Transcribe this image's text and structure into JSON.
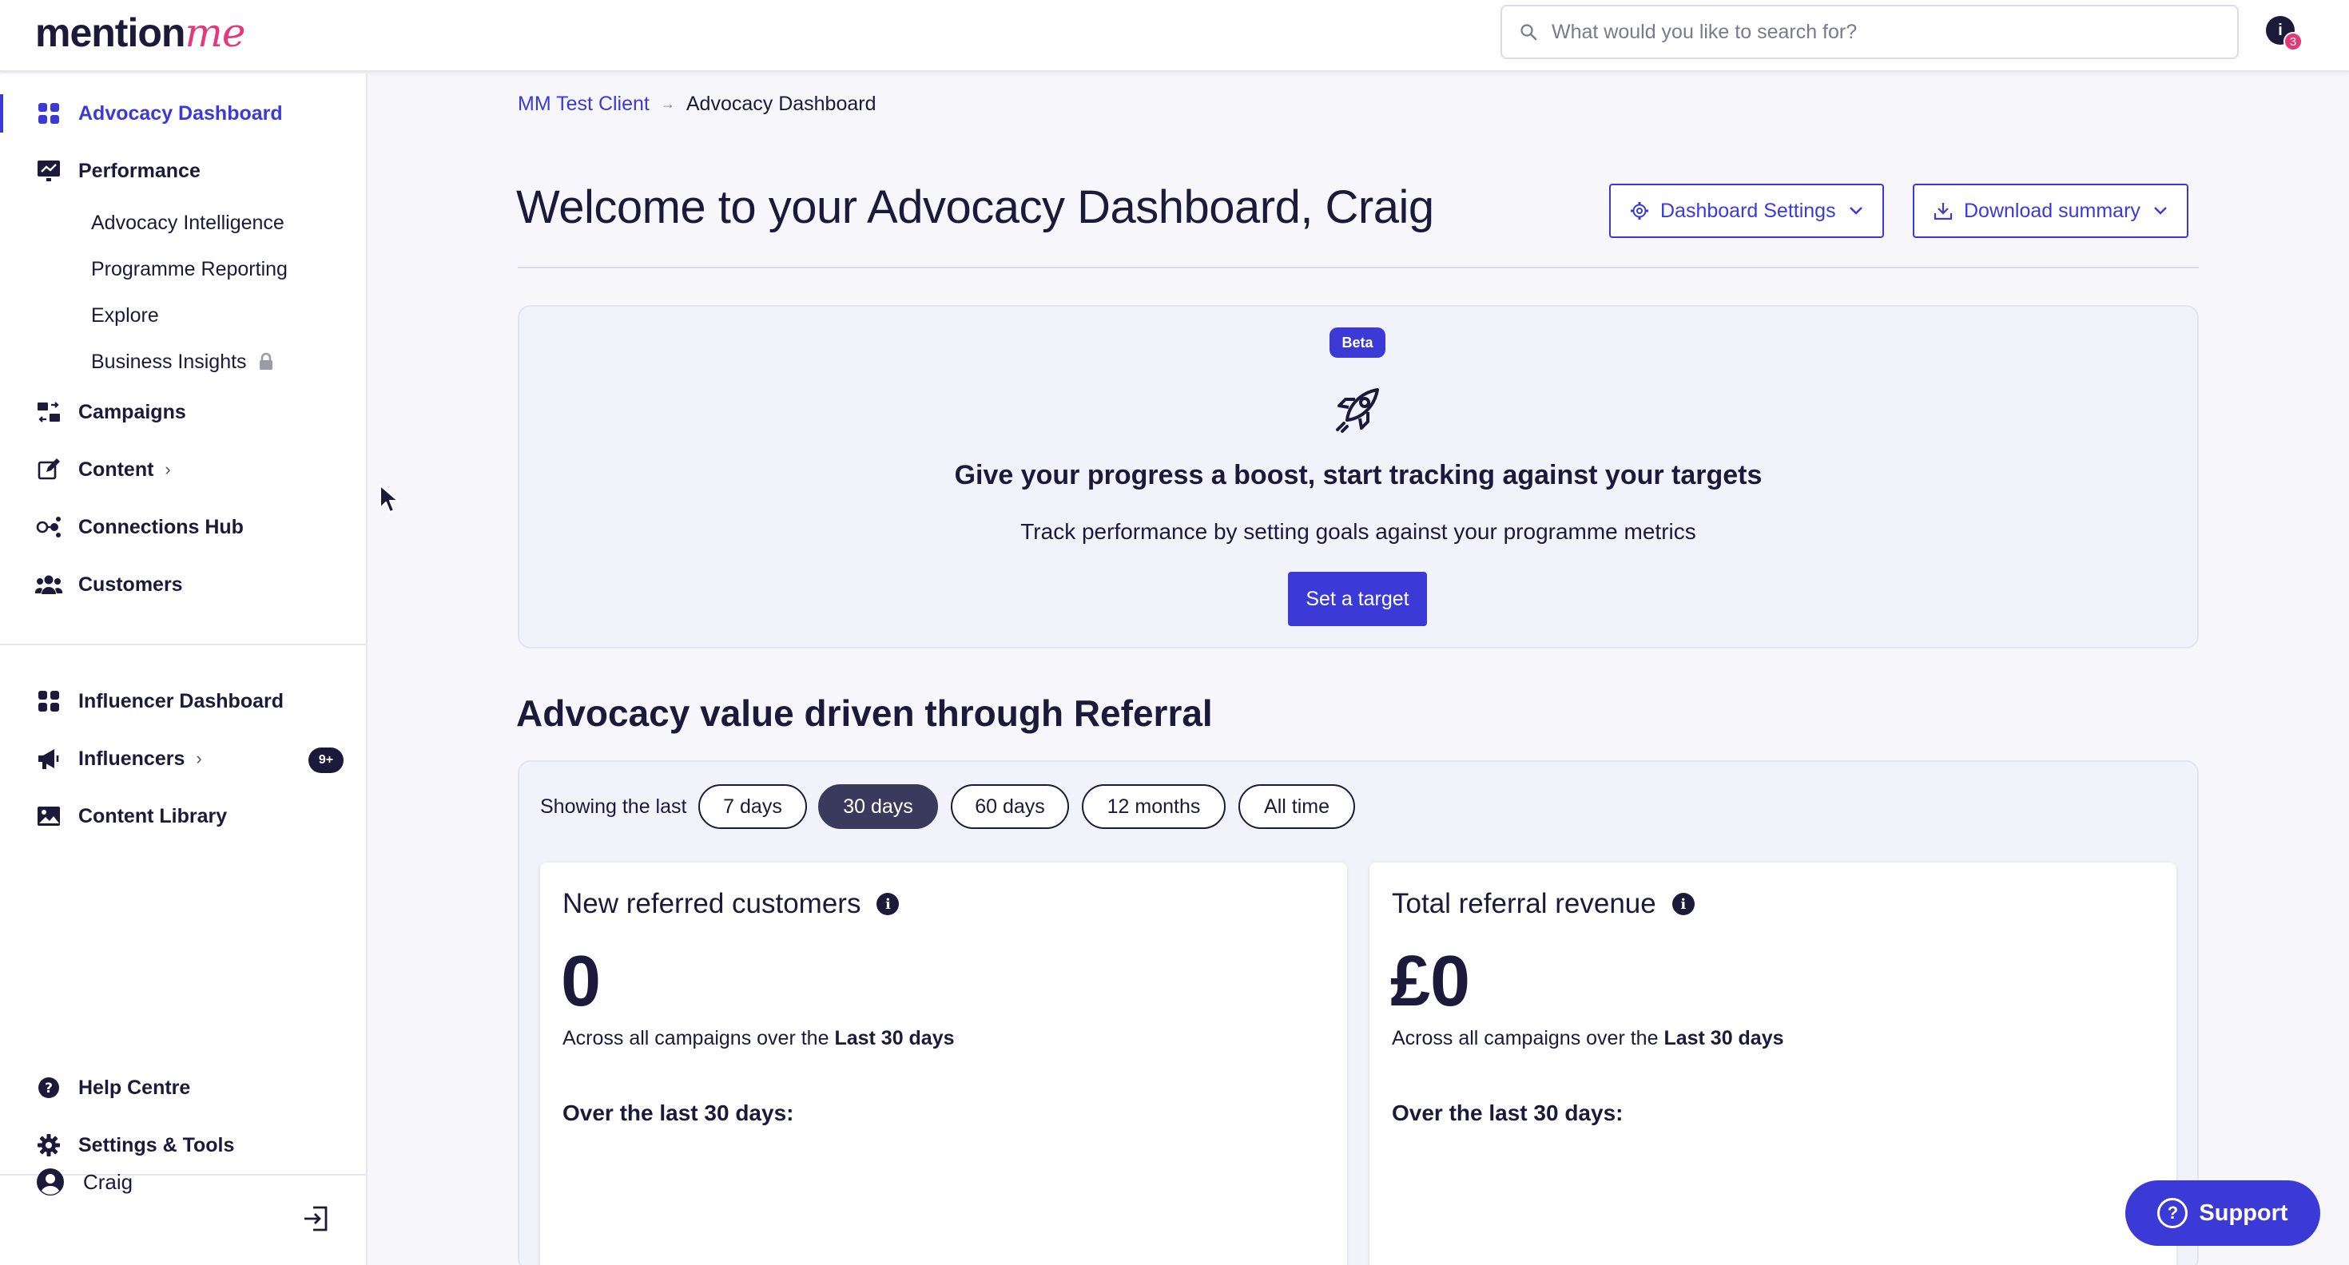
{
  "header": {
    "logo_part1": "mention",
    "logo_part2": "me",
    "search_placeholder": "What would you like to search for?",
    "notification_count": "3",
    "notification_letter": "i"
  },
  "sidebar": {
    "items": [
      {
        "label": "Advocacy Dashboard",
        "icon": "dashboard-grid-icon",
        "active": true
      },
      {
        "label": "Performance",
        "icon": "performance-chart-icon"
      },
      {
        "label": "Campaigns",
        "icon": "campaigns-icon"
      },
      {
        "label": "Content",
        "icon": "edit-icon"
      },
      {
        "label": "Connections Hub",
        "icon": "connections-icon"
      },
      {
        "label": "Customers",
        "icon": "customers-icon"
      },
      {
        "label": "Influencer Dashboard",
        "icon": "dashboard-grid-icon"
      },
      {
        "label": "Influencers",
        "icon": "megaphone-icon",
        "badge": "9+"
      },
      {
        "label": "Content Library",
        "icon": "image-icon"
      },
      {
        "label": "Help Centre",
        "icon": "help-icon"
      },
      {
        "label": "Settings & Tools",
        "icon": "gear-icon"
      }
    ],
    "performance_sub": [
      {
        "label": "Advocacy Intelligence"
      },
      {
        "label": "Programme Reporting"
      },
      {
        "label": "Explore"
      },
      {
        "label": "Business Insights",
        "locked": true
      }
    ],
    "user_name": "Craig"
  },
  "breadcrumb": {
    "parent": "MM Test Client",
    "current": "Advocacy Dashboard"
  },
  "main": {
    "title": "Welcome to your Advocacy Dashboard, Craig",
    "dashboard_settings_label": "Dashboard Settings",
    "download_summary_label": "Download summary",
    "promo": {
      "badge": "Beta",
      "title": "Give your progress a boost, start tracking against your targets",
      "subtitle": "Track performance by setting goals against your programme metrics",
      "button": "Set a target"
    },
    "section_title": "Advocacy value driven through Referral",
    "range_label": "Showing the last",
    "ranges": [
      "7 days",
      "30 days",
      "60 days",
      "12 months",
      "All time"
    ],
    "selected_range": "30 days",
    "cards": [
      {
        "title": "New referred customers",
        "value": "0",
        "desc_prefix": "Across all campaigns over the ",
        "desc_bold": "Last 30 days",
        "over": "Over the last 30 days:"
      },
      {
        "title": "Total referral revenue",
        "value": "£0",
        "desc_prefix": "Across all campaigns over the ",
        "desc_bold": "Last 30 days",
        "over": "Over the last 30 days:"
      }
    ]
  },
  "support_label": "Support",
  "colors": {
    "accent": "#3b3ad6",
    "brand_pink": "#e3387a",
    "text_dark": "#1b1a3a"
  }
}
